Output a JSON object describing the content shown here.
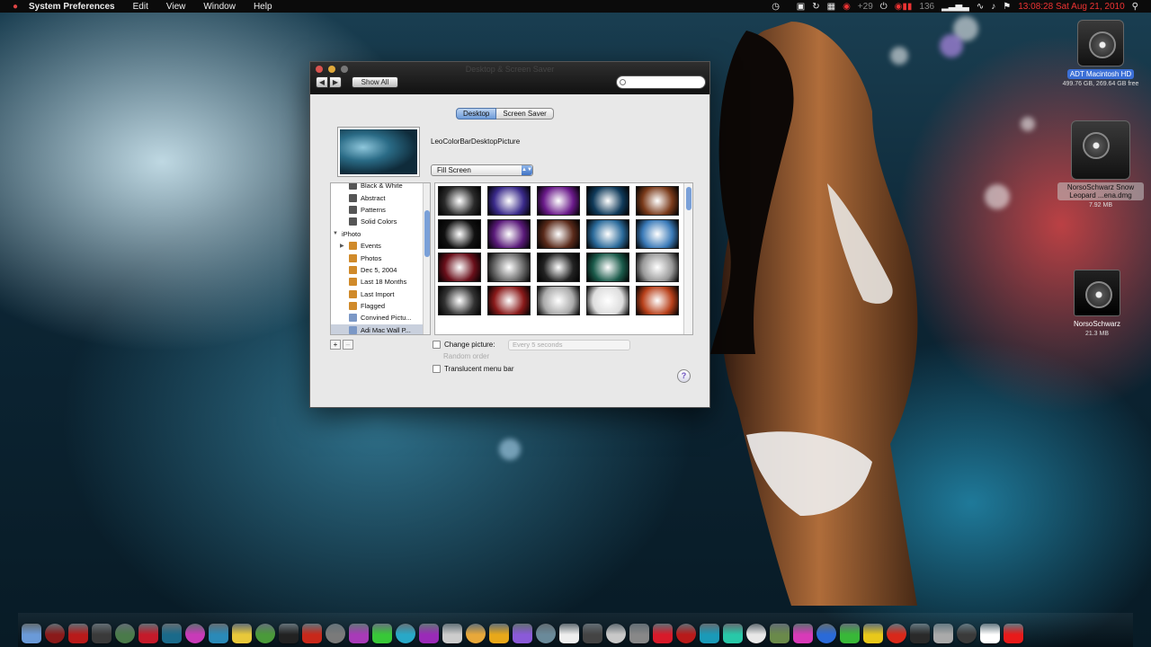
{
  "menubar": {
    "app_name": "System Preferences",
    "menus": [
      "Edit",
      "View",
      "Window",
      "Help"
    ],
    "status": {
      "temp": "+29",
      "counter": "136",
      "clock": "13:08:28  Sat  Aug 21, 2010"
    }
  },
  "window": {
    "title": "Desktop & Screen Saver",
    "show_all_label": "Show All",
    "search_placeholder": "",
    "tabs": [
      {
        "label": "Desktop",
        "active": true
      },
      {
        "label": "Screen Saver",
        "active": false
      }
    ],
    "current_picture_name": "LeoColorBarDesktopPicture",
    "fit_mode": "Fill Screen",
    "source_list": [
      {
        "label": "Black & White",
        "kind": "folder",
        "level": 1
      },
      {
        "label": "Abstract",
        "kind": "folder",
        "level": 1
      },
      {
        "label": "Patterns",
        "kind": "folder",
        "level": 1
      },
      {
        "label": "Solid Colors",
        "kind": "folder",
        "level": 1
      },
      {
        "label": "iPhoto",
        "kind": "group",
        "level": 0
      },
      {
        "label": "Events",
        "kind": "iphoto",
        "level": 1
      },
      {
        "label": "Photos",
        "kind": "iphoto",
        "level": 1
      },
      {
        "label": "Dec 5, 2004",
        "kind": "iphoto",
        "level": 1
      },
      {
        "label": "Last 18 Months",
        "kind": "iphoto",
        "level": 1
      },
      {
        "label": "Last Import",
        "kind": "iphoto",
        "level": 1
      },
      {
        "label": "Flagged",
        "kind": "iphoto",
        "level": 1
      },
      {
        "label": "Convined Pictu...",
        "kind": "folder",
        "level": 1
      },
      {
        "label": "Adi Mac Wall P...",
        "kind": "folder",
        "level": 1,
        "selected": true
      }
    ],
    "thumbnail_colors": [
      "#2b2b2b",
      "#3a2a8a",
      "#6a1a8a",
      "#0f3a5a",
      "#7a3a1a",
      "#111111",
      "#5a1a7a",
      "#5a2a1a",
      "#2a6a9a",
      "#3a7ab8",
      "#6a0f1a",
      "#666666",
      "#222222",
      "#1a5a4a",
      "#999999",
      "#333333",
      "#8a1a1a",
      "#aaaaaa",
      "#dddddd",
      "#b8401a"
    ],
    "change_picture_label": "Change picture:",
    "interval_value": "Every 5 seconds",
    "random_order_label": "Random order",
    "translucent_label": "Translucent menu bar",
    "help_label": "?"
  },
  "desktop_icons": [
    {
      "label": "ADT Macintosh HD",
      "sub": "499.76 GB, 269.64 GB free"
    },
    {
      "label": "NorsoSchwarz Snow Leopard ...ena.dmg",
      "sub": "7.92 MB"
    },
    {
      "label": "NorsoSchwarz",
      "sub": "21.3 MB"
    }
  ],
  "dock_colors": [
    "#6a9ad8",
    "#8a1a1a",
    "#b81a1a",
    "#3a3a3a",
    "#4a7a4a",
    "#c41a2a",
    "#1a6a8a",
    "#c83ab8",
    "#2a8ab8",
    "#e8c83a",
    "#4a9a3a",
    "#222222",
    "#c8281a",
    "#7a7a7a",
    "#a83ab8",
    "#38c838",
    "#28a8c8",
    "#9a2ab8",
    "#cccccc",
    "#e8a83a",
    "#e8a81a",
    "#8a5ad8",
    "#6a8a9a",
    "#eeeeee",
    "#444444",
    "#c8c8c8",
    "#888888",
    "#d81a2a",
    "#b81a1a",
    "#1a9ab8",
    "#28c8a8",
    "#e8e8e8",
    "#6a8a4a",
    "#d83ab8",
    "#2a6ad8",
    "#38b838",
    "#e8c81a",
    "#d8281a",
    "#2a2a2a",
    "#aaaaaa",
    "#3a3a3a",
    "#ffffff",
    "#e81a1a"
  ]
}
